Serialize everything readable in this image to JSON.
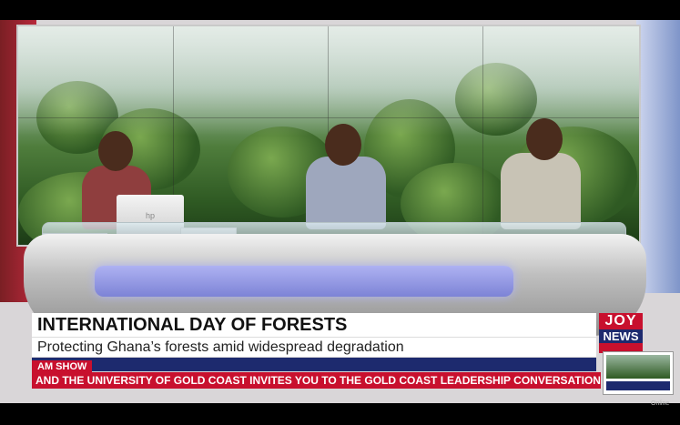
{
  "lower_third": {
    "headline": "INTERNATIONAL DAY OF FORESTS",
    "subheadline": "Protecting Ghana’s forests amid widespread degradation",
    "show_name": "AM SHOW"
  },
  "ticker": {
    "text": "AND THE UNIVERSITY OF GOLD COAST INVITES YOU TO THE GOLD COAST LEADERSHIP CONVERSATION"
  },
  "brand": {
    "logo_line1": "JOY",
    "logo_line2": "NEWS",
    "logo_line3": "",
    "accent_red": "#c8102e",
    "accent_navy": "#1d2a6e"
  },
  "laptop_brand": "hp",
  "corner_label": "Online"
}
